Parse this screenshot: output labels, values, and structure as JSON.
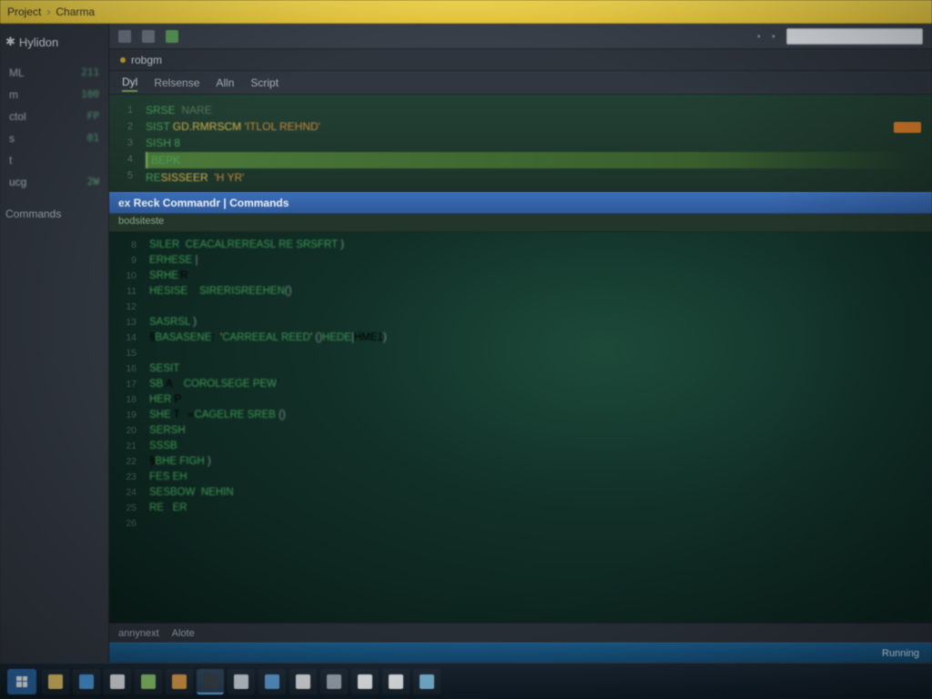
{
  "breadcrumb": {
    "root": "Project",
    "sep": "›",
    "current": "Charma"
  },
  "sidebar": {
    "brand": "Hylidon",
    "items": [
      {
        "label": "ML",
        "value": "211"
      },
      {
        "label": "m",
        "value": "100"
      },
      {
        "label": "ctol",
        "value": "FP"
      },
      {
        "label": "s",
        "value": "01"
      },
      {
        "label": "t",
        "value": ""
      },
      {
        "label": "ucg",
        "value": "2W"
      }
    ],
    "section": "Commands"
  },
  "toolbar": {
    "search_placeholder": ""
  },
  "file_tab": {
    "name": "robgm"
  },
  "sub_tabs": {
    "items": [
      "Dyl",
      "Relsense",
      "Alln",
      "Script"
    ],
    "active_index": 0
  },
  "editor_top": {
    "gutter": [
      "1",
      "2",
      "3",
      "4",
      "5"
    ],
    "lines": [
      {
        "kw": "SRSE",
        "rest": "  NARE"
      },
      {
        "kw": "SIST",
        "fn": " GD.RMRSCM",
        "str": " 'ITLOL REHND'"
      },
      {
        "kw": "SISH 8",
        "rest": ""
      },
      {
        "kw": "BEPK",
        "rest": "",
        "hl": true
      },
      {
        "kw": "RE",
        "fn": "SISSEER",
        "str": "  'H YR'"
      }
    ]
  },
  "panel": {
    "title": "ex Reck Commandr | Commands",
    "sub": "bodsiteste"
  },
  "editor_bottom": {
    "gutter": [
      "8",
      "9",
      "10",
      "11",
      "12",
      "13",
      "14",
      "15",
      "16",
      "17",
      "18",
      "19",
      "20",
      "21",
      "22",
      "23",
      "24",
      "25",
      "26"
    ],
    "lines": [
      "SILER  CEACALREREASL RE SRSFRT )",
      "ERHESE |",
      "SRHE'R",
      "HESISE    SIRERISREEHEN()",
      "",
      "SASRSL )",
      "§BASASENE:  'CARREEAL REED' ()HEDE|HME1)",
      "",
      "SESIT",
      "SB A    COROLSEGE PEW'",
      "HER P",
      "SHE T   «CAGELRE SREB ()",
      "SERSH",
      "SSSB",
      "§BHE FIGH )",
      "FES EH",
      "SESBOW  NEHIN",
      "RE   ER"
    ]
  },
  "bottom_tabs": {
    "items": [
      "annynext",
      "Alote"
    ]
  },
  "status": {
    "text": "Running"
  },
  "taskbar": {
    "apps": [
      {
        "name": "explorer",
        "color": "#e8c96a"
      },
      {
        "name": "browser",
        "color": "#4a9de0"
      },
      {
        "name": "mail",
        "color": "#e0e4e8"
      },
      {
        "name": "store",
        "color": "#8ac46a"
      },
      {
        "name": "notes",
        "color": "#d89a4a"
      },
      {
        "name": "terminal",
        "color": "#3a3f48",
        "active": true
      },
      {
        "name": "editor",
        "color": "#c8d0d8"
      },
      {
        "name": "files",
        "color": "#5a9ad0"
      },
      {
        "name": "media",
        "color": "#d8dce0"
      },
      {
        "name": "settings",
        "color": "#9aa4b0"
      },
      {
        "name": "doc1",
        "color": "#e8ecee"
      },
      {
        "name": "doc2",
        "color": "#e8ecee"
      },
      {
        "name": "app3",
        "color": "#7ab8d8"
      }
    ]
  }
}
